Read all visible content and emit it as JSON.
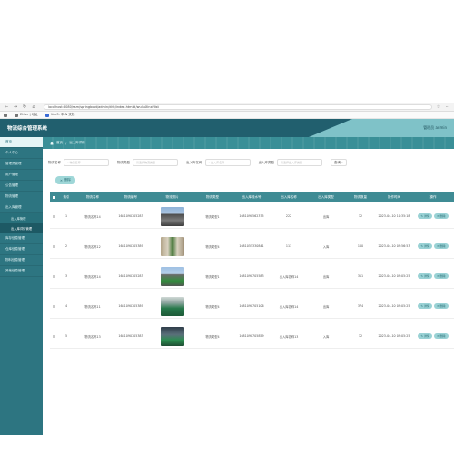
{
  "browser": {
    "url": "localhost:8080/ssm/springboot/admin/dist/index.html#/wuliuXinxi/list",
    "bookmarks": [
      "Ether | 地址",
      "Vue3: 中 & 文档"
    ]
  },
  "header": {
    "title": "物流综合管理系统",
    "user": "管理员 admin"
  },
  "sidebar": {
    "items": [
      {
        "label": "首页",
        "active": true
      },
      {
        "label": "个人中心"
      },
      {
        "label": "管理员管理"
      },
      {
        "label": "用户管理"
      },
      {
        "label": "公告管理"
      },
      {
        "label": "物流管理"
      },
      {
        "label": "出入库管理"
      }
    ],
    "sub_items": [
      {
        "label": "出入库管理"
      },
      {
        "label": "出入库详情管理",
        "current": true
      }
    ],
    "items_after": [
      {
        "label": "库存信息管理"
      },
      {
        "label": "仓库信息管理"
      },
      {
        "label": "物料信息管理"
      },
      {
        "label": "其他信息管理"
      }
    ]
  },
  "breadcrumb": {
    "home": "首页",
    "sep": "/",
    "current": "出入库详情"
  },
  "search": {
    "fields": [
      {
        "label": "物流名称",
        "placeholder": "物流名称"
      },
      {
        "label": "物流类型",
        "placeholder": "请选择物流类型"
      },
      {
        "label": "出入库名称",
        "placeholder": "出入库名称"
      },
      {
        "label": "出入库类型",
        "placeholder": "请选择出入库类型"
      }
    ],
    "button": "查询"
  },
  "delete_button": "删除",
  "table": {
    "headers": [
      "索引",
      "物流名称",
      "物流编号",
      "物流照片",
      "物流类型",
      "出入库流水号",
      "出入库名称",
      "出入库类型",
      "物流数量",
      "操作时间",
      "操作"
    ],
    "rows": [
      {
        "index": "1",
        "name": "物流名称14",
        "code": "1681090705283",
        "type": "物流类型1",
        "serial": "1681090562375",
        "io_name": "222",
        "io_type": "出库",
        "qty": "32",
        "time": "2023-04-10 10:35:18",
        "photo": "p1"
      },
      {
        "index": "2",
        "name": "物流名称12",
        "code": "1681090705389",
        "type": "物流类型4",
        "serial": "1681055330841",
        "io_name": "111",
        "io_type": "入库",
        "qty": "100",
        "time": "2023-04-10 09:56:53",
        "photo": "p2"
      },
      {
        "index": "3",
        "name": "物流名称14",
        "code": "1681090705283",
        "type": "物流类型1",
        "serial": "1681090705583",
        "io_name": "出入库名称14",
        "io_type": "出库",
        "qty": "311",
        "time": "2023-04-10 09:05:25",
        "photo": "p3"
      },
      {
        "index": "4",
        "name": "物流名称11",
        "code": "1681090705389",
        "type": "物流类型4",
        "serial": "1681090705106",
        "io_name": "出入库名称14",
        "io_type": "出库",
        "qty": "374",
        "time": "2023-04-10 09:05:25",
        "photo": "p4"
      },
      {
        "index": "5",
        "name": "物流名称13",
        "code": "1681090705383",
        "type": "物流类型4",
        "serial": "1681090705859",
        "io_name": "出入库名称13",
        "io_type": "入库",
        "qty": "32",
        "time": "2023-04-10 09:05:25",
        "photo": "p5"
      }
    ],
    "detail_label": "详情",
    "delete_label": "删除"
  },
  "colors": {
    "header": "#215f6e",
    "sidebar": "#2d7581",
    "table_head": "#3f8b94",
    "button": "#9ad2d5"
  }
}
